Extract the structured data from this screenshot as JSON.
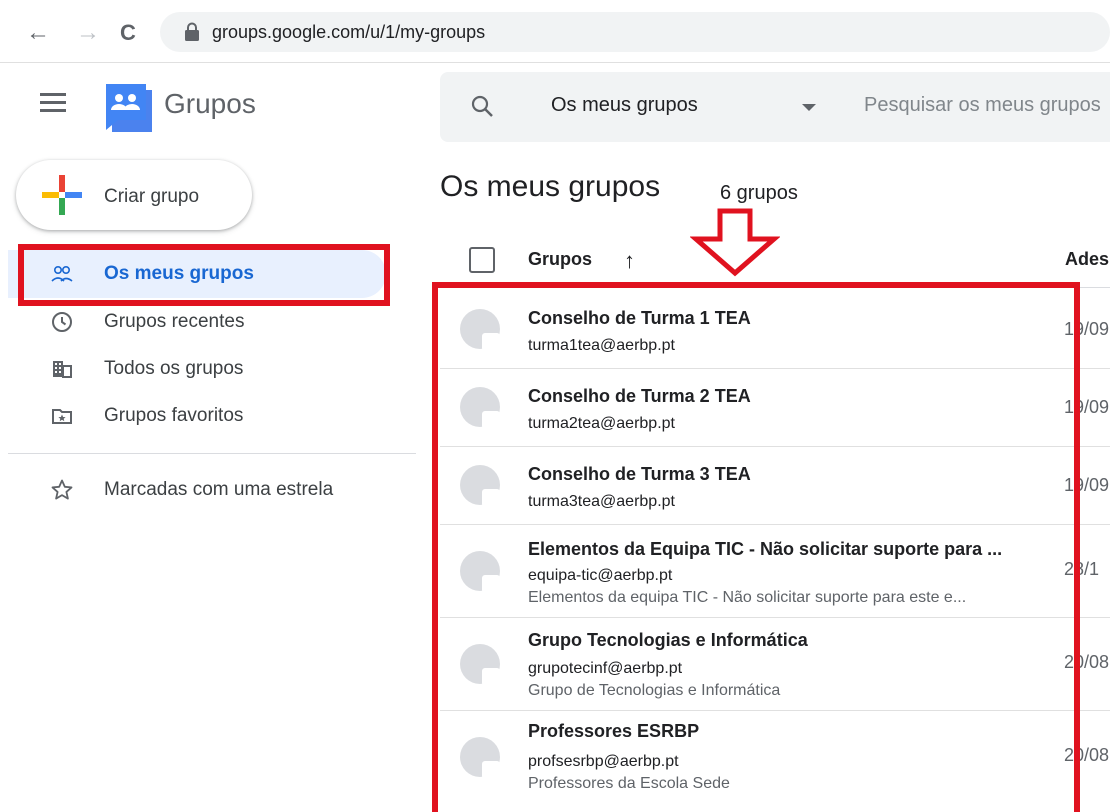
{
  "browser": {
    "back": "←",
    "forward": "→",
    "reload": "C",
    "url": "groups.google.com/u/1/my-groups"
  },
  "app": {
    "name": "Grupos"
  },
  "search": {
    "scope": "Os meus grupos",
    "placeholder": "Pesquisar os meus grupos"
  },
  "create_button": {
    "label": "Criar grupo"
  },
  "sidebar": {
    "items": [
      {
        "label": "Os meus grupos",
        "icon": "people-icon",
        "active": true
      },
      {
        "label": "Grupos recentes",
        "icon": "clock-icon",
        "active": false
      },
      {
        "label": "Todos os grupos",
        "icon": "domain-icon",
        "active": false
      },
      {
        "label": "Grupos favoritos",
        "icon": "folder-star-icon",
        "active": false
      },
      {
        "label": "Marcadas com uma estrela",
        "icon": "star-icon",
        "active": false
      }
    ]
  },
  "main": {
    "title": "Os meus grupos",
    "count": "6 grupos",
    "columns": {
      "groups": "Grupos",
      "joined": "Ades"
    },
    "rows": [
      {
        "name": "Conselho de Turma 1 TEA",
        "email": "turma1tea@aerbp.pt",
        "description": "",
        "date": "19/09"
      },
      {
        "name": "Conselho de Turma 2 TEA",
        "email": "turma2tea@aerbp.pt",
        "description": "",
        "date": "19/09"
      },
      {
        "name": "Conselho de Turma 3 TEA",
        "email": "turma3tea@aerbp.pt",
        "description": "",
        "date": "19/09"
      },
      {
        "name": "Elementos da Equipa TIC - Não solicitar suporte para ...",
        "email": "equipa-tic@aerbp.pt",
        "description": "Elementos da equipa TIC - Não solicitar suporte para este e...",
        "date": "28/1"
      },
      {
        "name": "Grupo Tecnologias e Informática",
        "email": "grupotecinf@aerbp.pt",
        "description": "Grupo de Tecnologias e Informática",
        "date": "20/08"
      },
      {
        "name": "Professores ESRBP",
        "email": "profsesrbp@aerbp.pt",
        "description": "Professores da Escola Sede",
        "date": "20/08"
      }
    ]
  },
  "colors": {
    "annotation_red": "#e0121f",
    "active_blue": "#1967d2",
    "active_bg": "#e8f0fe"
  }
}
